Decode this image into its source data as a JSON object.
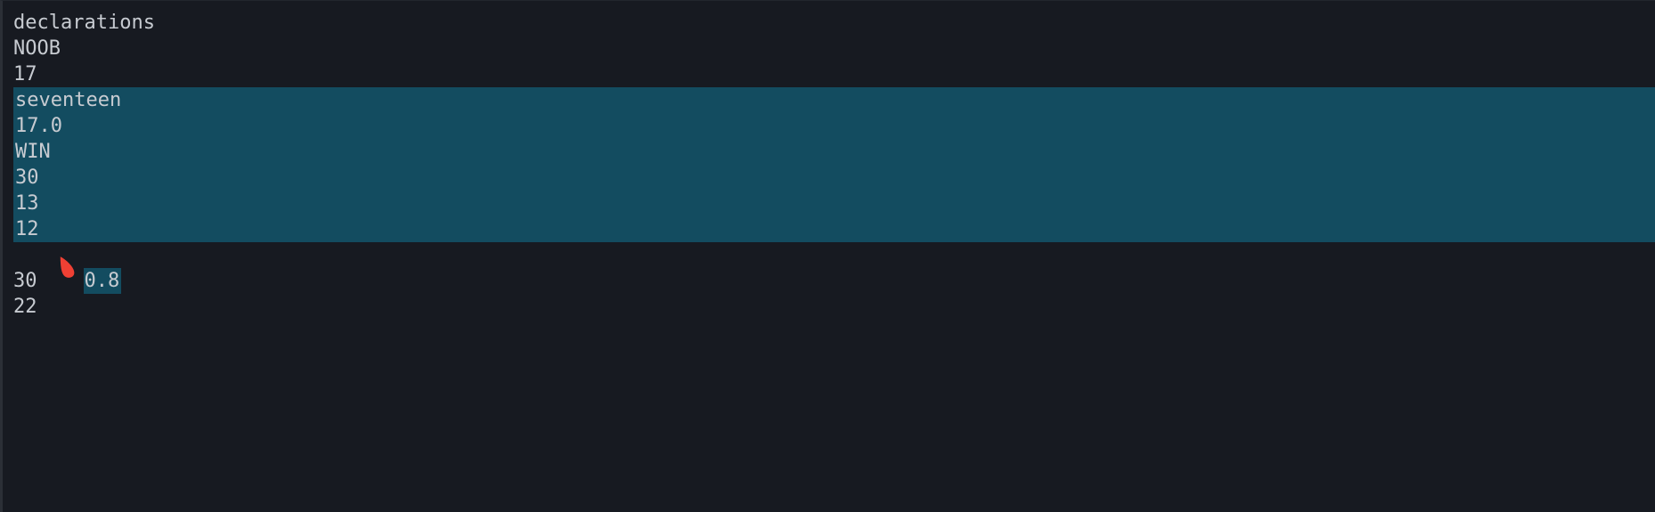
{
  "output": {
    "lines": [
      "declarations",
      "NOOB",
      "17",
      "seventeen",
      "17.0",
      "WIN",
      "30",
      "13",
      "12",
      "0.8",
      "30",
      "22"
    ]
  },
  "colors": {
    "background": "#171a21",
    "text": "#c7cbd1",
    "selection": "#134c60",
    "cursor": "#ef4034"
  },
  "cursor_icon": "mouse-pointer-icon"
}
